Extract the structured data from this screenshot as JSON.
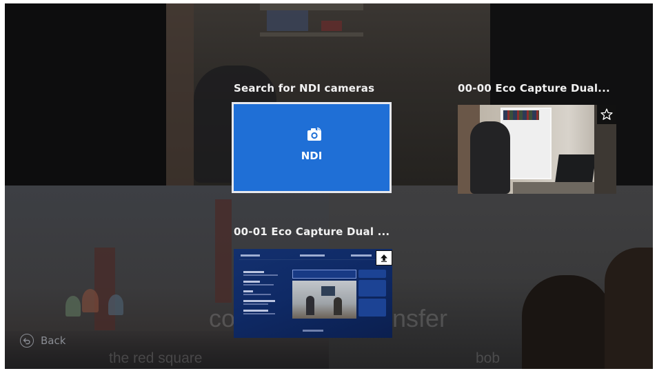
{
  "tiles": [
    {
      "label": "Search for NDI cameras",
      "card_text": "NDI",
      "icon": "camera-icon",
      "accent": "#1f6fd6",
      "selected": true
    },
    {
      "label": "00-00 Eco Capture Dual...",
      "favorite_icon": "star-icon"
    },
    {
      "label": "00-01 Eco Capture Dual ...",
      "action_icon": "upload-icon"
    }
  ],
  "back": {
    "label": "Back",
    "icon": "back-icon"
  },
  "background_captions": {
    "center_left": "co",
    "center_right": "nsfer",
    "bottom_left": "the red square",
    "bottom_right": "bob"
  }
}
